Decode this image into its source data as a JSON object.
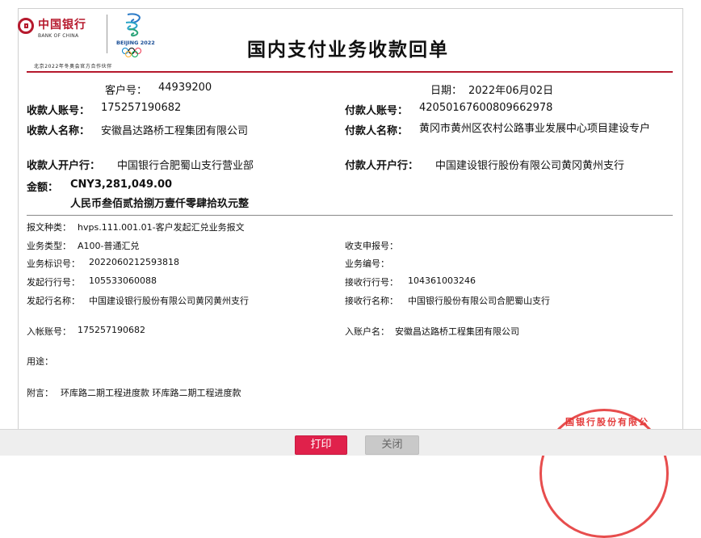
{
  "header": {
    "bank_name_cn": "中国银行",
    "bank_name_en": "BANK OF CHINA",
    "olympic_text": "BEIJING 2022",
    "partner_text": "北京2022年冬奥会官方合作伙伴",
    "title": "国内支付业务收款回单"
  },
  "summary": {
    "customer_no_label": "客户号：",
    "customer_no": "44939200",
    "date_label": "日期：",
    "date": "2022年06月02日",
    "payee_account_label": "收款人账号：",
    "payee_account": "175257190682",
    "payer_account_label": "付款人账号：",
    "payer_account": "42050167600809662978",
    "payee_name_label": "收款人名称：",
    "payee_name": "安徽昌达路桥工程集团有限公司",
    "payer_name_label": "付款人名称：",
    "payer_name": "黄冈市黄州区农村公路事业发展中心项目建设专户",
    "payee_bank_label": "收款人开户行：",
    "payee_bank": "中国银行合肥蜀山支行营业部",
    "payer_bank_label": "付款人开户行：",
    "payer_bank": "中国建设银行股份有限公司黄冈黄州支行",
    "amount_label": "金额：",
    "amount": "CNY3,281,049.00",
    "amount_words": "人民币叁佰贰拾捌万壹仟零肆拾玖元整"
  },
  "details": {
    "msg_type_label": "报文种类：",
    "msg_type": "hvps.111.001.01-客户发起汇兑业务报文",
    "biz_type_label": "业务类型：",
    "biz_type": "A100-普通汇兑",
    "receipt_no_label": "收支申报号：",
    "receipt_no": "",
    "biz_id_label": "业务标识号：",
    "biz_id": "2022060212593818",
    "biz_no_label": "业务编号：",
    "biz_no": "",
    "send_bank_no_label": "发起行行号：",
    "send_bank_no": "105533060088",
    "recv_bank_no_label": "接收行行号：",
    "recv_bank_no": "104361003246",
    "send_bank_name_label": "发起行名称：",
    "send_bank_name": "中国建设银行股份有限公司黄冈黄州支行",
    "recv_bank_name_label": "接收行名称：",
    "recv_bank_name": "中国银行股份有限公司合肥蜀山支行",
    "in_account_label": "入帐账号：",
    "in_account": "175257190682",
    "in_account_name_label": "入账户名：",
    "in_account_name": "安徽昌达路桥工程集团有限公司",
    "purpose_label": "用途：",
    "purpose": "",
    "remark_label": "附言：",
    "remark": "环库路二期工程进度款 环库路二期工程进度款"
  },
  "stamp": {
    "text": "国银行股份有限公"
  },
  "actions": {
    "print_label": "打印",
    "close_label": "关闭"
  },
  "colors": {
    "brand_red": "#b6192d",
    "print_button": "#e0214b",
    "stamp_red": "#e43a3a"
  }
}
